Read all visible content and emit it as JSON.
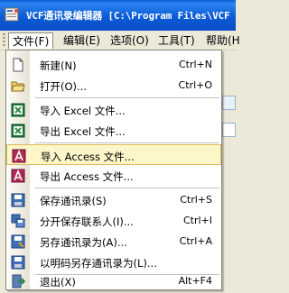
{
  "window": {
    "title": "VCF通讯录编辑器 [C:\\Program Files\\VCF"
  },
  "menubar": {
    "items": [
      "文件(F)",
      "编辑(E)",
      "选项(O)",
      "工具(T)",
      "帮助(H"
    ]
  },
  "file_menu": {
    "items": [
      {
        "label": "新建(N)",
        "shortcut": "Ctrl+N",
        "icon": "new-file-icon"
      },
      {
        "label": "打开(O)...",
        "shortcut": "Ctrl+O",
        "icon": "open-folder-icon"
      },
      {
        "label": "导入 Excel 文件...",
        "shortcut": "",
        "icon": "import-excel-icon"
      },
      {
        "label": "导出 Excel 文件...",
        "shortcut": "",
        "icon": "export-excel-icon"
      },
      {
        "label": "导入 Access 文件...",
        "shortcut": "",
        "icon": "import-access-icon",
        "highlighted": true
      },
      {
        "label": "导出 Access 文件...",
        "shortcut": "",
        "icon": "export-access-icon"
      },
      {
        "label": "保存通讯录(S)",
        "shortcut": "Ctrl+S",
        "icon": "save-icon"
      },
      {
        "label": "分开保存联系人(I)...",
        "shortcut": "Ctrl+I",
        "icon": "split-save-icon"
      },
      {
        "label": "另存通讯录为(A)...",
        "shortcut": "Ctrl+A",
        "icon": "save-as-icon"
      },
      {
        "label": "以明码另存通讯录为(L)...",
        "shortcut": "",
        "icon": "save-plain-icon"
      },
      {
        "label": "退出(X)",
        "shortcut": "Alt+F4",
        "icon": "exit-icon"
      }
    ]
  },
  "colors": {
    "titlebar": "#0a5fd8",
    "highlight_bg": "#fdf6c9",
    "highlight_border": "#e0b85a"
  }
}
